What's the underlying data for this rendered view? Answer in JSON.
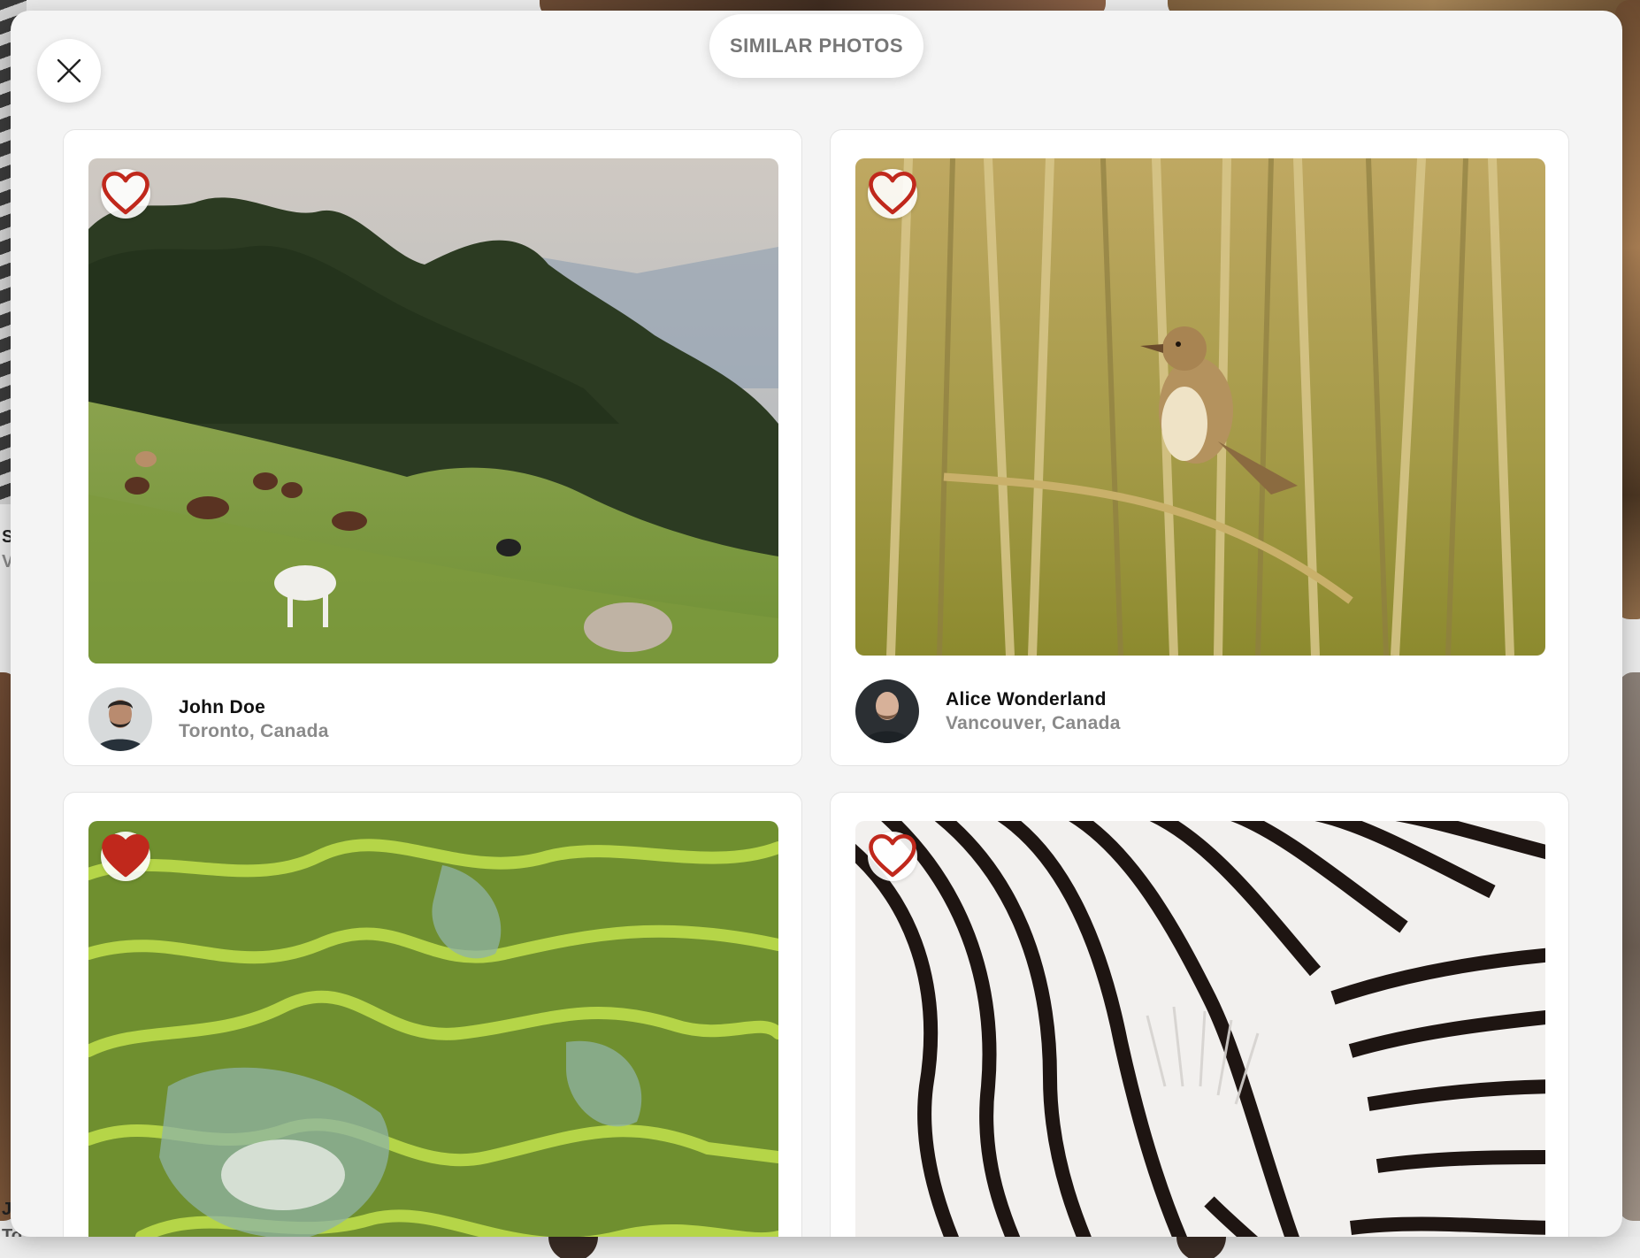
{
  "header": {
    "title": "SIMILAR PHOTOS",
    "close_icon": "close-icon"
  },
  "photos": [
    {
      "subject": "horses",
      "liked": false,
      "author": {
        "name": "John Doe",
        "location": "Toronto, Canada"
      }
    },
    {
      "subject": "bird-in-reeds",
      "liked": false,
      "author": {
        "name": "Alice Wonderland",
        "location": "Vancouver, Canada"
      }
    },
    {
      "subject": "rice-terraces",
      "liked": true
    },
    {
      "subject": "zebra-stripes",
      "liked": false
    }
  ],
  "background": {
    "visible_fragments": [
      "S",
      "V",
      "J",
      "To"
    ]
  },
  "colors": {
    "heart": "#c0281c",
    "modal_bg": "#f4f4f4",
    "title_text": "#777777"
  }
}
